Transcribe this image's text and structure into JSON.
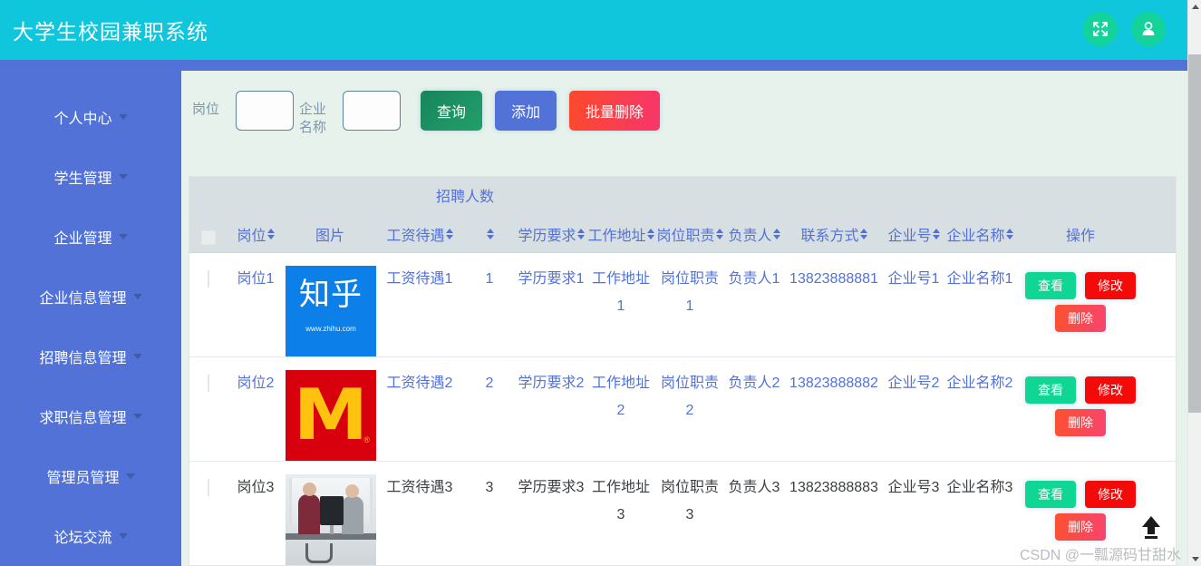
{
  "header": {
    "title": "大学生校园兼职系统",
    "bg_color": "#0fc6dc",
    "accent_color": "#5272d8",
    "actions": [
      {
        "name": "fullscreen-icon",
        "label": "全屏"
      },
      {
        "name": "user-icon",
        "label": "个人"
      }
    ]
  },
  "sidebar": {
    "bg_color": "#5272d8",
    "items": [
      {
        "label": "个人中心"
      },
      {
        "label": "学生管理"
      },
      {
        "label": "企业管理"
      },
      {
        "label": "企业信息管理"
      },
      {
        "label": "招聘信息管理"
      },
      {
        "label": "求职信息管理"
      },
      {
        "label": "管理员管理"
      },
      {
        "label": "论坛交流"
      }
    ]
  },
  "search": {
    "post_label": "岗位",
    "post_value": "",
    "post_placeholder": "",
    "company_label": "企业名称",
    "company_value": "",
    "company_placeholder": "",
    "query_label": "查询",
    "add_label": "添加",
    "batch_delete_label": "批量删除"
  },
  "table": {
    "overflow_label": "招聘人数",
    "headers": [
      {
        "label": "",
        "sortable": false
      },
      {
        "label": "岗位",
        "sortable": true
      },
      {
        "label": "图片",
        "sortable": false
      },
      {
        "label": "工资待遇",
        "sortable": true
      },
      {
        "label": "",
        "sortable": true
      },
      {
        "label": "学历要求",
        "sortable": true
      },
      {
        "label": "工作地址",
        "sortable": true
      },
      {
        "label": "岗位职责",
        "sortable": true
      },
      {
        "label": "负责人",
        "sortable": true
      },
      {
        "label": "联系方式",
        "sortable": true
      },
      {
        "label": "企业号",
        "sortable": true
      },
      {
        "label": "企业名称",
        "sortable": true
      },
      {
        "label": "操作",
        "sortable": false
      }
    ],
    "ops": {
      "view_label": "查看",
      "edit_label": "修改",
      "delete_label": "删除"
    },
    "rows": [
      {
        "post": "岗位1",
        "image": "zhihu-logo",
        "image_text": "知乎",
        "image_url_text": "www.zhihu.com",
        "salary": "工资待遇1",
        "count": "1",
        "education": "学历要求1",
        "address": "工作地址1",
        "duty": "岗位职责1",
        "owner": "负责人1",
        "phone": "13823888881",
        "company_no": "企业号1",
        "company_name": "企业名称1"
      },
      {
        "post": "岗位2",
        "image": "mcdonalds-logo",
        "image_text": "",
        "image_url_text": "",
        "salary": "工资待遇2",
        "count": "2",
        "education": "学历要求2",
        "address": "工作地址2",
        "duty": "岗位职责2",
        "owner": "负责人2",
        "phone": "13823888882",
        "company_no": "企业号2",
        "company_name": "企业名称2"
      },
      {
        "post": "岗位3",
        "image": "office-interview-photo",
        "image_text": "",
        "image_url_text": "",
        "salary": "工资待遇3",
        "count": "3",
        "education": "学历要求3",
        "address": "工作地址3",
        "duty": "岗位职责3",
        "owner": "负责人3",
        "phone": "13823888883",
        "company_no": "企业号3",
        "company_name": "企业名称3"
      }
    ]
  },
  "footer": {
    "watermark": "CSDN @一瓢源码甘甜水",
    "back_to_top": "回到顶部"
  }
}
